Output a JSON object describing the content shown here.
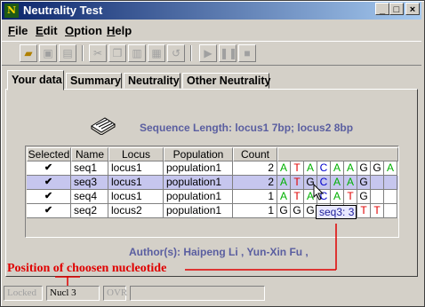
{
  "window": {
    "title": "Neutrality Test",
    "icon": "app-logo-icon"
  },
  "menu": [
    {
      "label": "File",
      "accel": "F",
      "rest": "ile"
    },
    {
      "label": "Edit",
      "accel": "E",
      "rest": "dit"
    },
    {
      "label": "Option",
      "accel": "O",
      "rest": "ption"
    },
    {
      "label": "Help",
      "accel": "H",
      "rest": "elp"
    }
  ],
  "tabs": [
    "Your data",
    "Summary",
    "Neutrality",
    "Other Neutrality"
  ],
  "selected_tab": "Your data",
  "sequence_length": "Sequence Length:  locus1 7bp; locus2 8bp",
  "table": {
    "headers": [
      "Selected",
      "Name",
      "Locus",
      "Population",
      "Count"
    ],
    "rows": [
      {
        "selected": "✔",
        "name": "seq1",
        "locus": "locus1",
        "population": "population1",
        "count": "2",
        "nucleotides": [
          "A",
          "T",
          "A",
          "C",
          "A",
          "A",
          "G",
          "G",
          "A"
        ]
      },
      {
        "selected": "✔",
        "name": "seq3",
        "locus": "locus1",
        "population": "population1",
        "count": "2",
        "nucleotides": [
          "A",
          "T",
          "G",
          "C",
          "A",
          "A",
          "G",
          "",
          ""
        ]
      },
      {
        "selected": "✔",
        "name": "seq4",
        "locus": "locus1",
        "population": "population1",
        "count": "1",
        "nucleotides": [
          "A",
          "T",
          "A",
          "C",
          "A",
          "T",
          "G",
          "",
          ""
        ]
      },
      {
        "selected": "✔",
        "name": "seq2",
        "locus": "locus2",
        "population": "population1",
        "count": "1",
        "nucleotides": [
          "G",
          "G",
          "G",
          "",
          "",
          "",
          "T",
          "T",
          ""
        ]
      }
    ],
    "highlighted_row": 1
  },
  "tooltip": "seq3: 3",
  "authors": "Author(s): Haipeng Li , Yun-Xin Fu ,",
  "annotation": "Position of choosen nucleotide",
  "status": [
    "Locked",
    "Nucl 3",
    "OVR",
    ""
  ],
  "colors": {
    "A": "#00b000",
    "T": "#e00000",
    "G": "#000000",
    "C": "#0000cc",
    "accent_text": "#5a5ea0",
    "annotation": "#e00000",
    "selection": "#c6c6ee"
  }
}
